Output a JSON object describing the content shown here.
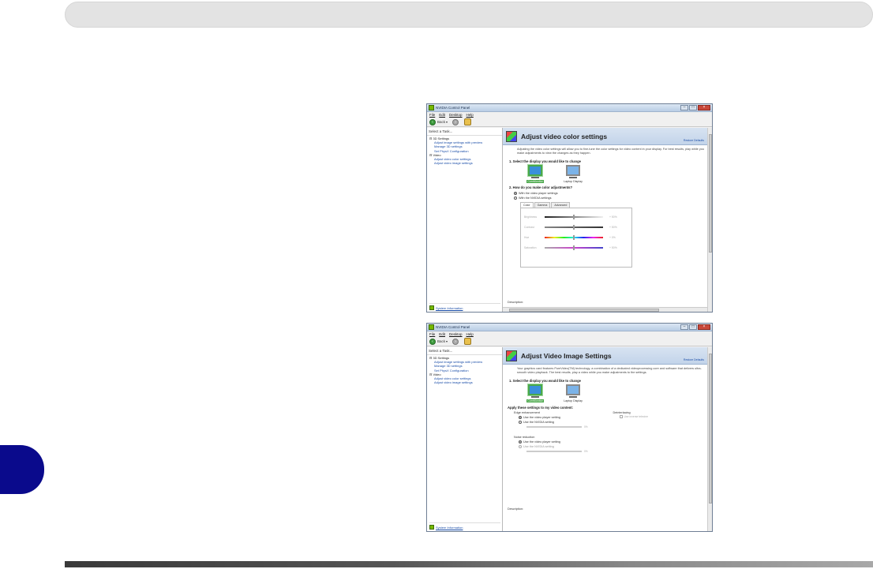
{
  "window1": {
    "title": "NVIDIA Control Panel",
    "menu": [
      "File",
      "Edit",
      "Desktop",
      "Help"
    ],
    "toolbar": {
      "back_label": "Back"
    },
    "tasks": {
      "header": "Select a Task...",
      "items": [
        {
          "label": "3D Settings",
          "level": 0
        },
        {
          "label": "Adjust image settings with preview",
          "level": 1
        },
        {
          "label": "Manage 3D settings",
          "level": 1
        },
        {
          "label": "Set PhysX Configuration",
          "level": 1
        },
        {
          "label": "Video",
          "level": 0
        },
        {
          "label": "Adjust video color settings",
          "level": 1,
          "selected": true
        },
        {
          "label": "Adjust video image settings",
          "level": 1
        }
      ],
      "system_info": "System Information"
    },
    "content": {
      "title": "Adjust video color settings",
      "restore": "Restore Defaults",
      "intro": "Adjusting the video color settings will allow you to fine-tune the color settings for video content in your display. For best results, play while you make adjustments to view the changes as they happen.",
      "step1": "1. Select the display you would like to change",
      "displays": [
        {
          "label": "ComMonitor",
          "selected": true
        },
        {
          "label": "Laptop Display",
          "selected": false
        }
      ],
      "step2": "2. How do you make color adjustments?",
      "option1": "With the video player settings",
      "option2": "With the NVIDIA settings",
      "tabs": [
        "Color",
        "Gamma",
        "Advanced"
      ],
      "sliders": [
        {
          "label": "Brightness",
          "value": "+ 50%"
        },
        {
          "label": "Contrast",
          "value": "+ 50%"
        },
        {
          "label": "Hue",
          "value": "+ 0%"
        },
        {
          "label": "Saturation",
          "value": "+ 50%"
        }
      ],
      "description": "Description:"
    }
  },
  "window2": {
    "title": "NVIDIA Control Panel",
    "menu": [
      "File",
      "Edit",
      "Desktop",
      "Help"
    ],
    "toolbar": {
      "back_label": "Back"
    },
    "tasks": {
      "header": "Select a Task...",
      "items": [
        {
          "label": "3D Settings",
          "level": 0
        },
        {
          "label": "Adjust image settings with preview",
          "level": 1
        },
        {
          "label": "Manage 3D settings",
          "level": 1
        },
        {
          "label": "Set PhysX Configuration",
          "level": 1
        },
        {
          "label": "Video",
          "level": 0
        },
        {
          "label": "Adjust video color settings",
          "level": 1
        },
        {
          "label": "Adjust video image settings",
          "level": 1,
          "selected": true
        }
      ],
      "system_info": "System Information"
    },
    "content": {
      "title": "Adjust Video Image Settings",
      "restore": "Restore Defaults",
      "intro": "Your graphics card features PureVideo(TM) technology, a combination of a dedicated videoprocessing core and software that delivers ultra-smooth video playback. The best results, play a video while you make adjustments to the settings.",
      "step1": "1. Select the display you would like to change",
      "displays": [
        {
          "label": "ComMonitor",
          "selected": true
        },
        {
          "label": "Laptop Display",
          "selected": false
        }
      ],
      "apply_title": "Apply these settings to my video content:",
      "edge": {
        "title": "Edge enhancement",
        "option1": "Use the video player setting",
        "option2": "Use the NVIDIA setting",
        "value": "0%"
      },
      "deinterlacing": {
        "title": "Deinterlacing",
        "checkbox": "Use inverse telecine"
      },
      "noise": {
        "title": "Noise reduction",
        "option1": "Use the video player setting",
        "option2": "Use the NVIDIA setting",
        "value": "0%"
      },
      "description": "Description:"
    }
  },
  "colors": {
    "header_bar": "#e3e3e3",
    "side_tab": "#0a0a8c",
    "nvidia_green": "#76b900",
    "selection_blue": "#3a6fd8"
  }
}
